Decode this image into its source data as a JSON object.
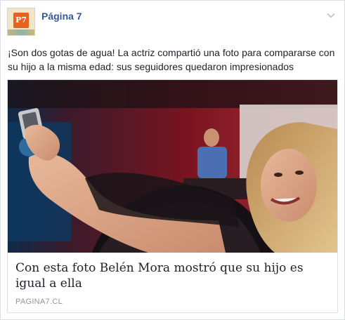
{
  "header": {
    "page_name": "Página 7",
    "avatar_text": "P7"
  },
  "post": {
    "caption": "¡Son dos gotas de agua! La actriz compartió una foto para compararse con su hijo a la misma edad: sus seguidores quedaron impresionados"
  },
  "link": {
    "title": "Con esta foto Belén Mora mostró que su hijo es igual a ella",
    "domain": "PAGINA7.CL"
  },
  "colors": {
    "brand_link": "#365899",
    "avatar_badge": "#e8611f"
  }
}
